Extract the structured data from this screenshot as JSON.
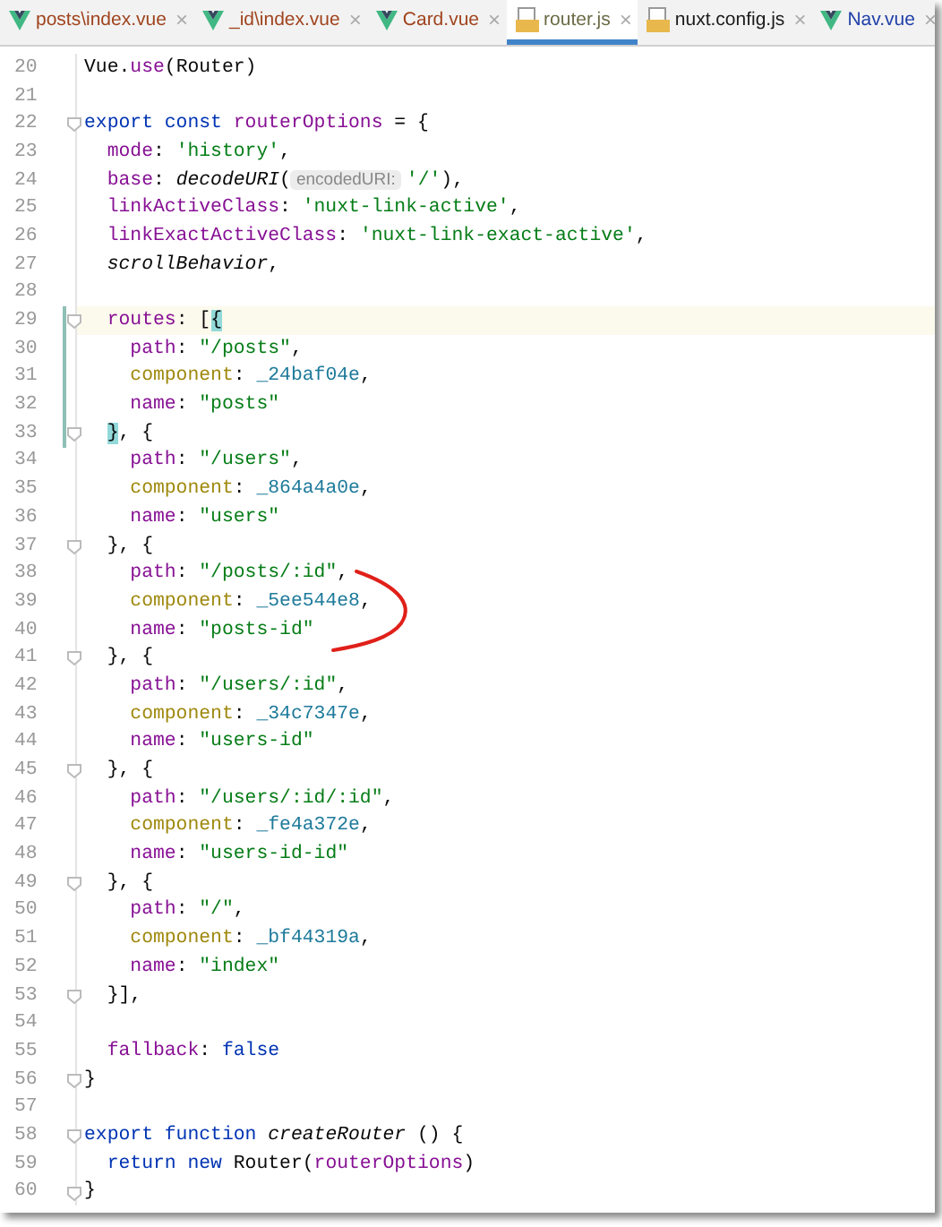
{
  "tabs": [
    {
      "label": "posts\\index.vue",
      "kind": "vue",
      "color": "#a0441e",
      "selected": false,
      "close": "×"
    },
    {
      "label": "_id\\index.vue",
      "kind": "vue",
      "color": "#a0441e",
      "selected": false,
      "close": "×"
    },
    {
      "label": "Card.vue",
      "kind": "vue",
      "color": "#a0441e",
      "selected": false,
      "close": "×"
    },
    {
      "label": "router.js",
      "kind": "js",
      "color": "#6b6b47",
      "selected": true,
      "close": "×"
    },
    {
      "label": "nuxt.config.js",
      "kind": "js",
      "color": "#1a1a1a",
      "selected": false,
      "close": "×"
    },
    {
      "label": "Nav.vue",
      "kind": "vue",
      "color": "#1f3fa8",
      "selected": false,
      "close": "×"
    }
  ],
  "editor": {
    "lines": [
      {
        "number": "20",
        "fold": false,
        "current": false,
        "in_scope": false,
        "tokens": [
          {
            "kind": "plain",
            "text": "Vue."
          },
          {
            "kind": "property",
            "text": "use"
          },
          {
            "kind": "plain",
            "text": "(Router)"
          }
        ]
      },
      {
        "number": "21",
        "fold": false,
        "current": false,
        "in_scope": false
      },
      {
        "number": "22",
        "fold": true,
        "current": false,
        "in_scope": false,
        "tokens": [
          {
            "kind": "keyword",
            "text": "export"
          },
          {
            "kind": "keyword",
            "text": " const"
          },
          {
            "kind": "property",
            "text": " routerOptions"
          },
          {
            "kind": "plain",
            "text": " = {"
          }
        ]
      },
      {
        "number": "23",
        "fold": false,
        "current": false,
        "in_scope": false,
        "tokens": [
          {
            "kind": "property",
            "text": "  mode"
          },
          {
            "kind": "plain",
            "text": ": "
          },
          {
            "kind": "string",
            "text": "'history'"
          },
          {
            "kind": "plain",
            "text": ","
          }
        ]
      },
      {
        "number": "24",
        "fold": false,
        "current": false,
        "in_scope": false,
        "tokens": [
          {
            "kind": "property",
            "text": "  base"
          },
          {
            "kind": "plain",
            "text": ": "
          },
          {
            "kind": "italic",
            "text": "decodeURI"
          },
          {
            "kind": "plain",
            "text": "("
          },
          {
            "kind": "hint",
            "text": "encodedURI:"
          },
          {
            "kind": "string",
            "text": "'/'"
          },
          {
            "kind": "plain",
            "text": "),"
          }
        ]
      },
      {
        "number": "25",
        "fold": false,
        "current": false,
        "in_scope": false,
        "tokens": [
          {
            "kind": "property",
            "text": "  linkActiveClass"
          },
          {
            "kind": "plain",
            "text": ": "
          },
          {
            "kind": "string",
            "text": "'nuxt-link-active'"
          },
          {
            "kind": "plain",
            "text": ","
          }
        ]
      },
      {
        "number": "26",
        "fold": false,
        "current": false,
        "in_scope": false,
        "tokens": [
          {
            "kind": "property",
            "text": "  linkExactActiveClass"
          },
          {
            "kind": "plain",
            "text": ": "
          },
          {
            "kind": "string",
            "text": "'nuxt-link-exact-active'"
          },
          {
            "kind": "plain",
            "text": ","
          }
        ]
      },
      {
        "number": "27",
        "fold": false,
        "current": false,
        "in_scope": false,
        "tokens": [
          {
            "kind": "italic",
            "text": "  scrollBehavior"
          },
          {
            "kind": "plain",
            "text": ","
          }
        ]
      },
      {
        "number": "28",
        "fold": false,
        "current": false,
        "in_scope": false
      },
      {
        "number": "29",
        "fold": true,
        "current": true,
        "in_scope": true,
        "tokens": [
          {
            "kind": "property",
            "text": "  routes"
          },
          {
            "kind": "plain",
            "text": ": ["
          },
          {
            "kind": "brace-match",
            "text": "{"
          }
        ]
      },
      {
        "number": "30",
        "fold": false,
        "current": false,
        "in_scope": true,
        "tokens": [
          {
            "kind": "property",
            "text": "    path"
          },
          {
            "kind": "plain",
            "text": ": "
          },
          {
            "kind": "string",
            "text": "\"/posts\""
          },
          {
            "kind": "plain",
            "text": ","
          }
        ]
      },
      {
        "number": "31",
        "fold": false,
        "current": false,
        "in_scope": true,
        "tokens": [
          {
            "kind": "field",
            "text": "    component"
          },
          {
            "kind": "plain",
            "text": ": "
          },
          {
            "kind": "ident",
            "text": "_24baf04e"
          },
          {
            "kind": "plain",
            "text": ","
          }
        ]
      },
      {
        "number": "32",
        "fold": false,
        "current": false,
        "in_scope": true,
        "tokens": [
          {
            "kind": "property",
            "text": "    name"
          },
          {
            "kind": "plain",
            "text": ": "
          },
          {
            "kind": "string",
            "text": "\"posts\""
          }
        ]
      },
      {
        "number": "33",
        "fold": true,
        "current": false,
        "in_scope": true,
        "tokens": [
          {
            "kind": "brace-match",
            "text": "  }"
          },
          {
            "kind": "plain",
            "text": ", {"
          }
        ]
      },
      {
        "number": "34",
        "fold": false,
        "current": false,
        "in_scope": false,
        "tokens": [
          {
            "kind": "property",
            "text": "    path"
          },
          {
            "kind": "plain",
            "text": ": "
          },
          {
            "kind": "string",
            "text": "\"/users\""
          },
          {
            "kind": "plain",
            "text": ","
          }
        ]
      },
      {
        "number": "35",
        "fold": false,
        "current": false,
        "in_scope": false,
        "tokens": [
          {
            "kind": "field",
            "text": "    component"
          },
          {
            "kind": "plain",
            "text": ": "
          },
          {
            "kind": "ident",
            "text": "_864a4a0e"
          },
          {
            "kind": "plain",
            "text": ","
          }
        ]
      },
      {
        "number": "36",
        "fold": false,
        "current": false,
        "in_scope": false,
        "tokens": [
          {
            "kind": "property",
            "text": "    name"
          },
          {
            "kind": "plain",
            "text": ": "
          },
          {
            "kind": "string",
            "text": "\"users\""
          }
        ]
      },
      {
        "number": "37",
        "fold": true,
        "current": false,
        "in_scope": false,
        "tokens": [
          {
            "kind": "plain",
            "text": "  }, {"
          }
        ]
      },
      {
        "number": "38",
        "fold": false,
        "current": false,
        "in_scope": false,
        "tokens": [
          {
            "kind": "property",
            "text": "    path"
          },
          {
            "kind": "plain",
            "text": ": "
          },
          {
            "kind": "string",
            "text": "\"/posts/:id\""
          },
          {
            "kind": "plain",
            "text": ","
          }
        ]
      },
      {
        "number": "39",
        "fold": false,
        "current": false,
        "in_scope": false,
        "tokens": [
          {
            "kind": "field",
            "text": "    component"
          },
          {
            "kind": "plain",
            "text": ": "
          },
          {
            "kind": "ident",
            "text": "_5ee544e8"
          },
          {
            "kind": "plain",
            "text": ","
          }
        ]
      },
      {
        "number": "40",
        "fold": false,
        "current": false,
        "in_scope": false,
        "tokens": [
          {
            "kind": "property",
            "text": "    name"
          },
          {
            "kind": "plain",
            "text": ": "
          },
          {
            "kind": "string",
            "text": "\"posts-id\""
          }
        ]
      },
      {
        "number": "41",
        "fold": true,
        "current": false,
        "in_scope": false,
        "tokens": [
          {
            "kind": "plain",
            "text": "  }, {"
          }
        ]
      },
      {
        "number": "42",
        "fold": false,
        "current": false,
        "in_scope": false,
        "tokens": [
          {
            "kind": "property",
            "text": "    path"
          },
          {
            "kind": "plain",
            "text": ": "
          },
          {
            "kind": "string",
            "text": "\"/users/:id\""
          },
          {
            "kind": "plain",
            "text": ","
          }
        ]
      },
      {
        "number": "43",
        "fold": false,
        "current": false,
        "in_scope": false,
        "tokens": [
          {
            "kind": "field",
            "text": "    component"
          },
          {
            "kind": "plain",
            "text": ": "
          },
          {
            "kind": "ident",
            "text": "_34c7347e"
          },
          {
            "kind": "plain",
            "text": ","
          }
        ]
      },
      {
        "number": "44",
        "fold": false,
        "current": false,
        "in_scope": false,
        "tokens": [
          {
            "kind": "property",
            "text": "    name"
          },
          {
            "kind": "plain",
            "text": ": "
          },
          {
            "kind": "string",
            "text": "\"users-id\""
          }
        ]
      },
      {
        "number": "45",
        "fold": true,
        "current": false,
        "in_scope": false,
        "tokens": [
          {
            "kind": "plain",
            "text": "  }, {"
          }
        ]
      },
      {
        "number": "46",
        "fold": false,
        "current": false,
        "in_scope": false,
        "tokens": [
          {
            "kind": "property",
            "text": "    path"
          },
          {
            "kind": "plain",
            "text": ": "
          },
          {
            "kind": "string",
            "text": "\"/users/:id/:id\""
          },
          {
            "kind": "plain",
            "text": ","
          }
        ]
      },
      {
        "number": "47",
        "fold": false,
        "current": false,
        "in_scope": false,
        "tokens": [
          {
            "kind": "field",
            "text": "    component"
          },
          {
            "kind": "plain",
            "text": ": "
          },
          {
            "kind": "ident",
            "text": "_fe4a372e"
          },
          {
            "kind": "plain",
            "text": ","
          }
        ]
      },
      {
        "number": "48",
        "fold": false,
        "current": false,
        "in_scope": false,
        "tokens": [
          {
            "kind": "property",
            "text": "    name"
          },
          {
            "kind": "plain",
            "text": ": "
          },
          {
            "kind": "string",
            "text": "\"users-id-id\""
          }
        ]
      },
      {
        "number": "49",
        "fold": true,
        "current": false,
        "in_scope": false,
        "tokens": [
          {
            "kind": "plain",
            "text": "  }, {"
          }
        ]
      },
      {
        "number": "50",
        "fold": false,
        "current": false,
        "in_scope": false,
        "tokens": [
          {
            "kind": "property",
            "text": "    path"
          },
          {
            "kind": "plain",
            "text": ": "
          },
          {
            "kind": "string",
            "text": "\"/\""
          },
          {
            "kind": "plain",
            "text": ","
          }
        ]
      },
      {
        "number": "51",
        "fold": false,
        "current": false,
        "in_scope": false,
        "tokens": [
          {
            "kind": "field",
            "text": "    component"
          },
          {
            "kind": "plain",
            "text": ": "
          },
          {
            "kind": "ident",
            "text": "_bf44319a"
          },
          {
            "kind": "plain",
            "text": ","
          }
        ]
      },
      {
        "number": "52",
        "fold": false,
        "current": false,
        "in_scope": false,
        "tokens": [
          {
            "kind": "property",
            "text": "    name"
          },
          {
            "kind": "plain",
            "text": ": "
          },
          {
            "kind": "string",
            "text": "\"index\""
          }
        ]
      },
      {
        "number": "53",
        "fold": true,
        "current": false,
        "in_scope": false,
        "tokens": [
          {
            "kind": "plain",
            "text": "  }],"
          }
        ]
      },
      {
        "number": "54",
        "fold": false,
        "current": false,
        "in_scope": false
      },
      {
        "number": "55",
        "fold": false,
        "current": false,
        "in_scope": false,
        "tokens": [
          {
            "kind": "property",
            "text": "  fallback"
          },
          {
            "kind": "plain",
            "text": ": "
          },
          {
            "kind": "keyword",
            "text": "false"
          }
        ]
      },
      {
        "number": "56",
        "fold": true,
        "current": false,
        "in_scope": false,
        "tokens": [
          {
            "kind": "plain",
            "text": "}"
          }
        ]
      },
      {
        "number": "57",
        "fold": false,
        "current": false,
        "in_scope": false
      },
      {
        "number": "58",
        "fold": true,
        "current": false,
        "in_scope": false,
        "tokens": [
          {
            "kind": "keyword",
            "text": "export"
          },
          {
            "kind": "keyword",
            "text": " function"
          },
          {
            "kind": "italic",
            "text": " createRouter"
          },
          {
            "kind": "plain",
            "text": " () {"
          }
        ]
      },
      {
        "number": "59",
        "fold": false,
        "current": false,
        "in_scope": false,
        "tokens": [
          {
            "kind": "keyword",
            "text": "  return"
          },
          {
            "kind": "keyword",
            "text": " new"
          },
          {
            "kind": "plain",
            "text": " Router("
          },
          {
            "kind": "property",
            "text": "routerOptions"
          },
          {
            "kind": "plain",
            "text": ")"
          }
        ]
      },
      {
        "number": "60",
        "fold": true,
        "current": false,
        "in_scope": false,
        "tokens": [
          {
            "kind": "plain",
            "text": "}"
          }
        ]
      }
    ]
  }
}
